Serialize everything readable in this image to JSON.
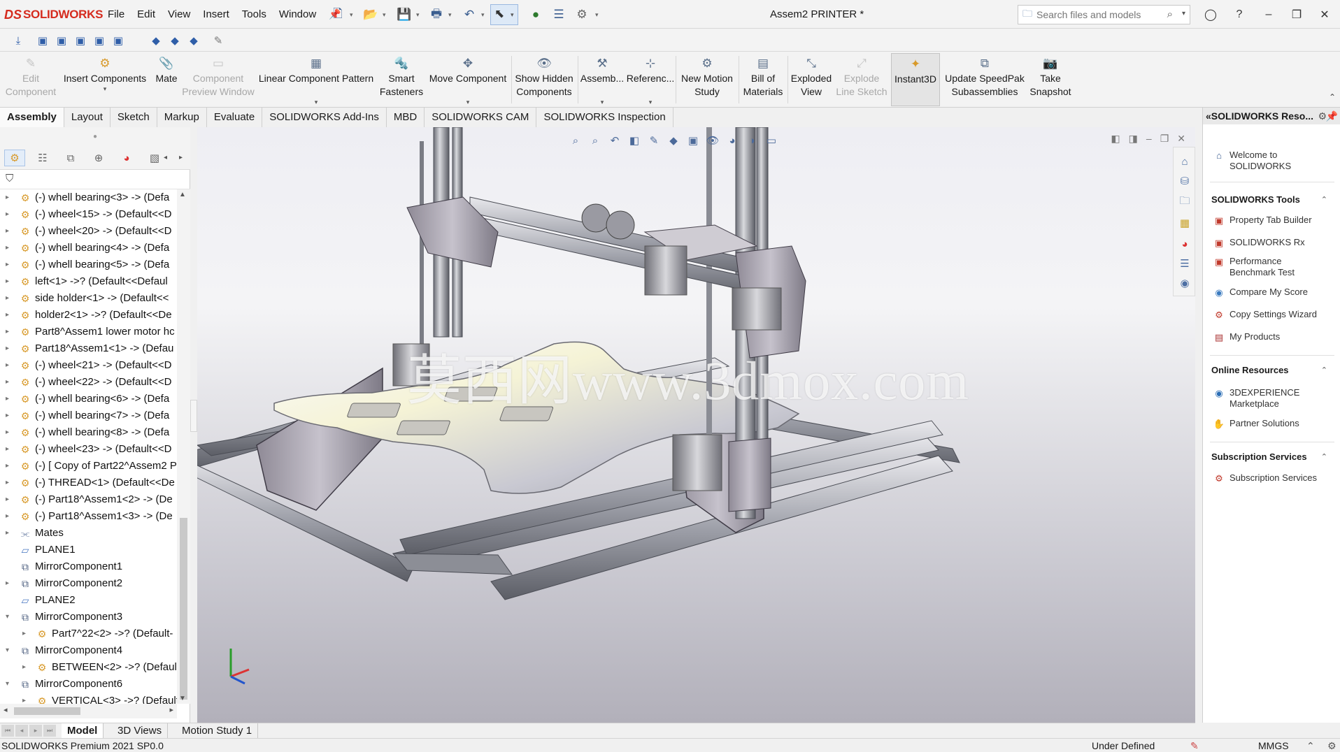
{
  "app": {
    "logo_text": "SOLIDWORKS",
    "logo_mark": "DS",
    "window_title": "Assem2 PRINTER *"
  },
  "menu": [
    "File",
    "Edit",
    "View",
    "Insert",
    "Tools",
    "Window"
  ],
  "search": {
    "placeholder": "Search files and models"
  },
  "ribbon": {
    "edit_component": "Edit Component",
    "insert_components": "Insert Components",
    "mate": "Mate",
    "component_preview": "Component Preview Window",
    "linear_pattern": "Linear Component Pattern",
    "smart_fasteners": "Smart Fasteners",
    "move_component": "Move Component",
    "show_hidden": "Show Hidden Components",
    "assembly": "Assemb...",
    "reference": "Referenc...",
    "new_motion_study": "New Motion Study",
    "bill_of_materials": "Bill of Materials",
    "exploded_view": "Exploded View",
    "explode_line_sketch": "Explode Line Sketch",
    "instant3d": "Instant3D",
    "update_speedpak": "Update SpeedPak Subassemblies",
    "take_snapshot": "Take Snapshot"
  },
  "tabs": [
    "Assembly",
    "Layout",
    "Sketch",
    "Markup",
    "Evaluate",
    "SOLIDWORKS Add-Ins",
    "MBD",
    "SOLIDWORKS CAM",
    "SOLIDWORKS Inspection"
  ],
  "tree": [
    {
      "label": "(-) whell bearing<3> -> (Defa",
      "icon": "component-icon",
      "expander": "▸"
    },
    {
      "label": "(-) wheel<15> -> (Default<<D",
      "icon": "component-icon",
      "expander": "▸"
    },
    {
      "label": "(-) wheel<20> -> (Default<<D",
      "icon": "component-icon",
      "expander": "▸"
    },
    {
      "label": "(-) whell bearing<4> -> (Defa",
      "icon": "component-icon",
      "expander": "▸"
    },
    {
      "label": "(-) whell bearing<5> -> (Defa",
      "icon": "component-icon",
      "expander": "▸"
    },
    {
      "label": "left<1> ->? (Default<<Defaul",
      "icon": "component-icon",
      "expander": "▸"
    },
    {
      "label": "side holder<1> -> (Default<<",
      "icon": "component-icon",
      "expander": "▸"
    },
    {
      "label": "holder2<1> ->? (Default<<De",
      "icon": "component-icon",
      "expander": "▸"
    },
    {
      "label": "Part8^Assem1 lower motor hc",
      "icon": "component-icon",
      "expander": "▸"
    },
    {
      "label": "Part18^Assem1<1> -> (Defau",
      "icon": "component-icon",
      "expander": "▸"
    },
    {
      "label": "(-) wheel<21> -> (Default<<D",
      "icon": "component-icon",
      "expander": "▸"
    },
    {
      "label": "(-) wheel<22> -> (Default<<D",
      "icon": "component-icon",
      "expander": "▸"
    },
    {
      "label": "(-) whell bearing<6> -> (Defa",
      "icon": "component-icon",
      "expander": "▸"
    },
    {
      "label": "(-) whell bearing<7> -> (Defa",
      "icon": "component-icon",
      "expander": "▸"
    },
    {
      "label": "(-) whell bearing<8> -> (Defa",
      "icon": "component-icon",
      "expander": "▸"
    },
    {
      "label": "(-) wheel<23> -> (Default<<D",
      "icon": "component-icon",
      "expander": "▸"
    },
    {
      "label": "(-) [ Copy of Part22^Assem2 P",
      "icon": "component-icon",
      "expander": "▸"
    },
    {
      "label": "(-) THREAD<1> (Default<<De",
      "icon": "component-icon",
      "expander": "▸"
    },
    {
      "label": "(-) Part18^Assem1<2> -> (De",
      "icon": "component-icon",
      "expander": "▸"
    },
    {
      "label": "(-) Part18^Assem1<3> -> (De",
      "icon": "component-icon",
      "expander": "▸"
    },
    {
      "label": "Mates",
      "icon": "mates-icon",
      "expander": "▸"
    },
    {
      "label": "PLANE1",
      "icon": "plane-icon",
      "expander": ""
    },
    {
      "label": "MirrorComponent1",
      "icon": "mirror-component-icon",
      "expander": ""
    },
    {
      "label": "MirrorComponent2",
      "icon": "mirror-component-icon",
      "expander": "▸"
    },
    {
      "label": "PLANE2",
      "icon": "plane-icon",
      "expander": ""
    },
    {
      "label": "MirrorComponent3",
      "icon": "mirror-component-icon",
      "expander": "▾"
    },
    {
      "label": "Part7^22<2> ->? (Default-",
      "icon": "component-icon",
      "expander": "▸"
    },
    {
      "label": "MirrorComponent4",
      "icon": "mirror-component-icon",
      "expander": "▾"
    },
    {
      "label": "BETWEEN<2> ->? (Default",
      "icon": "component-icon",
      "expander": "▸"
    },
    {
      "label": "MirrorComponent6",
      "icon": "mirror-component-icon",
      "expander": "▾"
    },
    {
      "label": "VERTICAL<3> ->? (Default",
      "icon": "component-icon",
      "expander": "▸"
    }
  ],
  "watermark": "莫西网www.3dmox.com",
  "taskpane": {
    "title": "SOLIDWORKS Reso...",
    "welcome": "Welcome to SOLIDWORKS",
    "tools_header": "SOLIDWORKS Tools",
    "tools": [
      "Property Tab Builder",
      "SOLIDWORKS Rx",
      "Performance Benchmark Test",
      "Compare My Score",
      "Copy Settings Wizard",
      "My Products"
    ],
    "online_header": "Online Resources",
    "online": [
      "3DEXPERIENCE Marketplace",
      "Partner Solutions"
    ],
    "subs_header": "Subscription Services",
    "subs": [
      "Subscription Services"
    ]
  },
  "bottom_tabs": [
    "Model",
    "3D Views",
    "Motion Study 1"
  ],
  "status": {
    "product": "SOLIDWORKS Premium 2021 SP0.0",
    "state": "Under Defined",
    "units": "MMGS"
  },
  "colors": {
    "brand": "#d52b1e",
    "component_icon": "#d89a2b",
    "active_tab_bg": "#fafafa"
  }
}
